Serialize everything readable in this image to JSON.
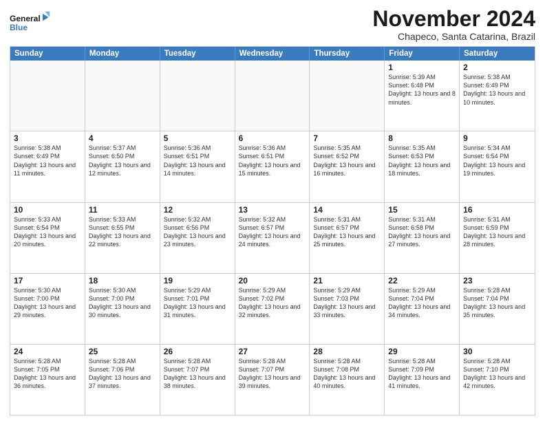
{
  "logo": {
    "line1": "General",
    "line2": "Blue"
  },
  "title": "November 2024",
  "location": "Chapeco, Santa Catarina, Brazil",
  "days_of_week": [
    "Sunday",
    "Monday",
    "Tuesday",
    "Wednesday",
    "Thursday",
    "Friday",
    "Saturday"
  ],
  "weeks": [
    [
      {
        "day": "",
        "text": ""
      },
      {
        "day": "",
        "text": ""
      },
      {
        "day": "",
        "text": ""
      },
      {
        "day": "",
        "text": ""
      },
      {
        "day": "",
        "text": ""
      },
      {
        "day": "1",
        "text": "Sunrise: 5:39 AM\nSunset: 6:48 PM\nDaylight: 13 hours and 8 minutes."
      },
      {
        "day": "2",
        "text": "Sunrise: 5:38 AM\nSunset: 6:49 PM\nDaylight: 13 hours and 10 minutes."
      }
    ],
    [
      {
        "day": "3",
        "text": "Sunrise: 5:38 AM\nSunset: 6:49 PM\nDaylight: 13 hours and 11 minutes."
      },
      {
        "day": "4",
        "text": "Sunrise: 5:37 AM\nSunset: 6:50 PM\nDaylight: 13 hours and 12 minutes."
      },
      {
        "day": "5",
        "text": "Sunrise: 5:36 AM\nSunset: 6:51 PM\nDaylight: 13 hours and 14 minutes."
      },
      {
        "day": "6",
        "text": "Sunrise: 5:36 AM\nSunset: 6:51 PM\nDaylight: 13 hours and 15 minutes."
      },
      {
        "day": "7",
        "text": "Sunrise: 5:35 AM\nSunset: 6:52 PM\nDaylight: 13 hours and 16 minutes."
      },
      {
        "day": "8",
        "text": "Sunrise: 5:35 AM\nSunset: 6:53 PM\nDaylight: 13 hours and 18 minutes."
      },
      {
        "day": "9",
        "text": "Sunrise: 5:34 AM\nSunset: 6:54 PM\nDaylight: 13 hours and 19 minutes."
      }
    ],
    [
      {
        "day": "10",
        "text": "Sunrise: 5:33 AM\nSunset: 6:54 PM\nDaylight: 13 hours and 20 minutes."
      },
      {
        "day": "11",
        "text": "Sunrise: 5:33 AM\nSunset: 6:55 PM\nDaylight: 13 hours and 22 minutes."
      },
      {
        "day": "12",
        "text": "Sunrise: 5:32 AM\nSunset: 6:56 PM\nDaylight: 13 hours and 23 minutes."
      },
      {
        "day": "13",
        "text": "Sunrise: 5:32 AM\nSunset: 6:57 PM\nDaylight: 13 hours and 24 minutes."
      },
      {
        "day": "14",
        "text": "Sunrise: 5:31 AM\nSunset: 6:57 PM\nDaylight: 13 hours and 25 minutes."
      },
      {
        "day": "15",
        "text": "Sunrise: 5:31 AM\nSunset: 6:58 PM\nDaylight: 13 hours and 27 minutes."
      },
      {
        "day": "16",
        "text": "Sunrise: 5:31 AM\nSunset: 6:59 PM\nDaylight: 13 hours and 28 minutes."
      }
    ],
    [
      {
        "day": "17",
        "text": "Sunrise: 5:30 AM\nSunset: 7:00 PM\nDaylight: 13 hours and 29 minutes."
      },
      {
        "day": "18",
        "text": "Sunrise: 5:30 AM\nSunset: 7:00 PM\nDaylight: 13 hours and 30 minutes."
      },
      {
        "day": "19",
        "text": "Sunrise: 5:29 AM\nSunset: 7:01 PM\nDaylight: 13 hours and 31 minutes."
      },
      {
        "day": "20",
        "text": "Sunrise: 5:29 AM\nSunset: 7:02 PM\nDaylight: 13 hours and 32 minutes."
      },
      {
        "day": "21",
        "text": "Sunrise: 5:29 AM\nSunset: 7:03 PM\nDaylight: 13 hours and 33 minutes."
      },
      {
        "day": "22",
        "text": "Sunrise: 5:29 AM\nSunset: 7:04 PM\nDaylight: 13 hours and 34 minutes."
      },
      {
        "day": "23",
        "text": "Sunrise: 5:28 AM\nSunset: 7:04 PM\nDaylight: 13 hours and 35 minutes."
      }
    ],
    [
      {
        "day": "24",
        "text": "Sunrise: 5:28 AM\nSunset: 7:05 PM\nDaylight: 13 hours and 36 minutes."
      },
      {
        "day": "25",
        "text": "Sunrise: 5:28 AM\nSunset: 7:06 PM\nDaylight: 13 hours and 37 minutes."
      },
      {
        "day": "26",
        "text": "Sunrise: 5:28 AM\nSunset: 7:07 PM\nDaylight: 13 hours and 38 minutes."
      },
      {
        "day": "27",
        "text": "Sunrise: 5:28 AM\nSunset: 7:07 PM\nDaylight: 13 hours and 39 minutes."
      },
      {
        "day": "28",
        "text": "Sunrise: 5:28 AM\nSunset: 7:08 PM\nDaylight: 13 hours and 40 minutes."
      },
      {
        "day": "29",
        "text": "Sunrise: 5:28 AM\nSunset: 7:09 PM\nDaylight: 13 hours and 41 minutes."
      },
      {
        "day": "30",
        "text": "Sunrise: 5:28 AM\nSunset: 7:10 PM\nDaylight: 13 hours and 42 minutes."
      }
    ]
  ]
}
